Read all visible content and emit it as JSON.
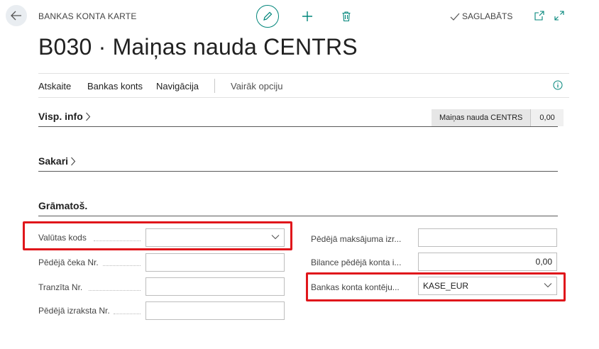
{
  "header": {
    "context_label": "BANKAS KONTA KARTE",
    "saved_status": "SAGLABĀTS",
    "title": "B030 · Maiņas nauda CENTRS"
  },
  "actions": {
    "items": [
      "Atskaite",
      "Bankas konts",
      "Navigācija"
    ],
    "more": "Vairāk opciju"
  },
  "sections": {
    "general": "Visp. info",
    "contacts": "Sakari",
    "posting": "Grāmatoš."
  },
  "summary": {
    "name": "Maiņas nauda CENTRS",
    "value": "0,00"
  },
  "fields": {
    "currency_code": {
      "label": "Valūtas kods",
      "value": ""
    },
    "last_check_no": {
      "label": "Pēdējā čeka Nr.",
      "value": ""
    },
    "transit_no": {
      "label": "Tranzīta Nr.",
      "value": ""
    },
    "last_statement_no": {
      "label": "Pēdējā izraksta Nr.",
      "value": ""
    },
    "last_payment": {
      "label": "Pēdējā maksājuma izr...",
      "value": ""
    },
    "balance_last": {
      "label": "Bilance pēdējā konta i...",
      "value": "0,00"
    },
    "posting_group": {
      "label": "Bankas konta kontēju...",
      "value": "KASE_EUR"
    }
  },
  "colors": {
    "accent": "#00857a",
    "highlight": "#e0161b"
  },
  "icons": [
    "back-arrow-icon",
    "pencil-icon",
    "plus-icon",
    "trash-icon",
    "checkmark-icon",
    "open-in-new-window-icon",
    "expand-icon",
    "info-icon",
    "chevron-right-icon",
    "chevron-down-icon"
  ]
}
